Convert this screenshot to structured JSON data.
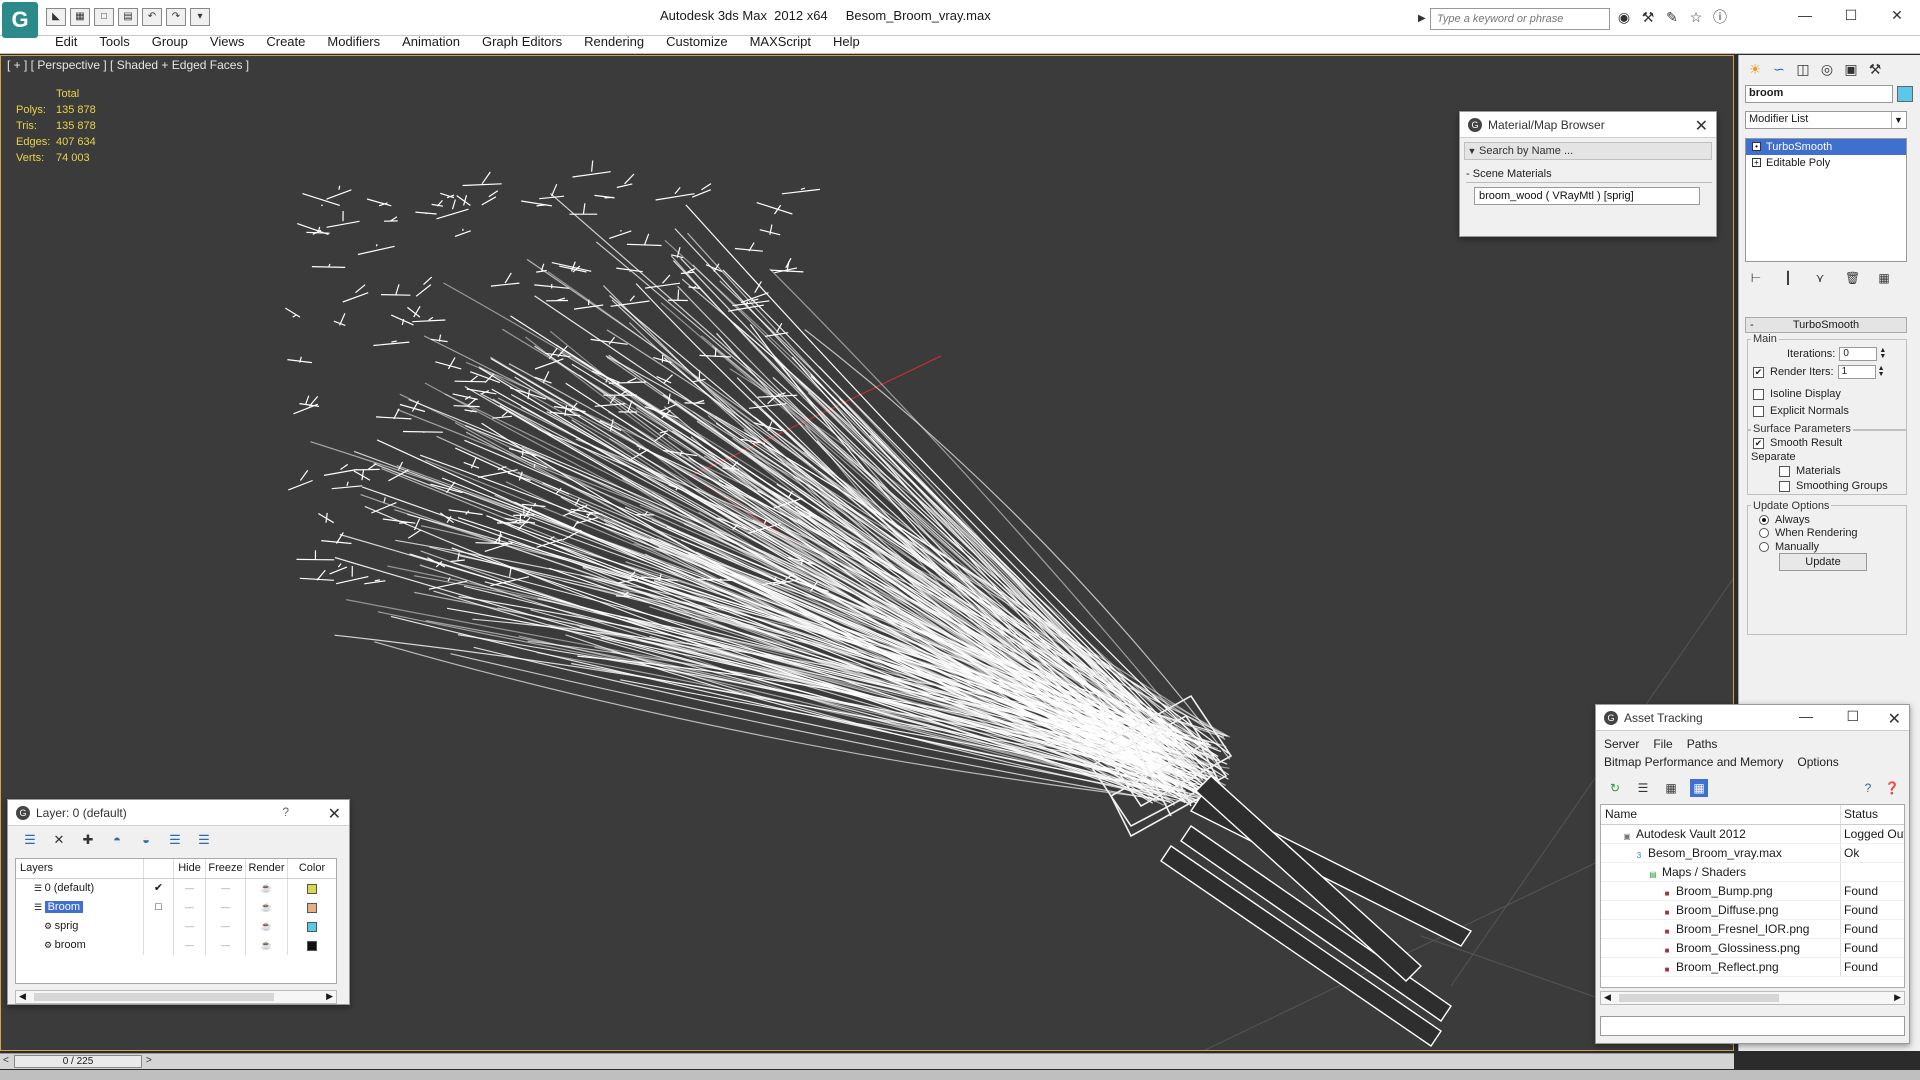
{
  "app": {
    "title": "Autodesk 3ds Max  2012 x64     Besom_Broom_vray.max",
    "logo": "3ds-max-logo",
    "search_placeholder": "Type a keyword or phrase"
  },
  "menu": [
    "Edit",
    "Tools",
    "Group",
    "Views",
    "Create",
    "Modifiers",
    "Animation",
    "Graph Editors",
    "Rendering",
    "Customize",
    "MAXScript",
    "Help"
  ],
  "viewport": {
    "label": "[ + ] [ Perspective ] [ Shaded + Edged Faces ]",
    "stats": {
      "header": "Total",
      "rows": [
        {
          "k": "Polys:",
          "v": "135 878"
        },
        {
          "k": "Tris:",
          "v": "135 878"
        },
        {
          "k": "Edges:",
          "v": "407 634"
        },
        {
          "k": "Verts:",
          "v": "74 003"
        }
      ]
    }
  },
  "material_browser": {
    "title": "Material/Map Browser",
    "search": "Search by Name ...",
    "section": "Scene Materials",
    "entry": "broom_wood  ( VRayMtl )  [sprig]"
  },
  "command_panel": {
    "object_name": "broom",
    "object_color": "#5cc8e8",
    "modifier_list": "Modifier List",
    "stack": [
      {
        "label": "TurboSmooth",
        "selected": true
      },
      {
        "label": "Editable Poly",
        "selected": false
      }
    ],
    "rollout": "TurboSmooth",
    "main_group": "Main",
    "iterations_label": "Iterations:",
    "iterations_value": "0",
    "render_iters_label": "Render Iters:",
    "render_iters_value": "1",
    "isoline": "Isoline Display",
    "explicit_normals": "Explicit Normals",
    "surface_group": "Surface Parameters",
    "smooth_result": "Smooth Result",
    "separate": "Separate",
    "materials": "Materials",
    "smoothing_groups": "Smoothing Groups",
    "update_group": "Update Options",
    "always": "Always",
    "when_rendering": "When Rendering",
    "manually": "Manually",
    "update_btn": "Update"
  },
  "layer_manager": {
    "title": "Layer: 0 (default)",
    "help": "?",
    "columns": [
      "Layers",
      "Hide",
      "Freeze",
      "Render",
      "Color"
    ],
    "rows": [
      {
        "name": "0 (default)",
        "indent": 1,
        "current": "✔",
        "color": "#d8d84a",
        "selected": false
      },
      {
        "name": "Broom",
        "indent": 1,
        "current": "□",
        "color": "#e8b080",
        "selected": true
      },
      {
        "name": "sprig",
        "indent": 2,
        "current": "",
        "color": "#5cc8e8",
        "selected": false
      },
      {
        "name": "broom",
        "indent": 2,
        "current": "",
        "color": "#111111",
        "selected": false
      }
    ]
  },
  "asset_tracking": {
    "title": "Asset Tracking",
    "menu": [
      "Server",
      "File",
      "Paths"
    ],
    "menu2": [
      "Bitmap Performance and Memory",
      "Options"
    ],
    "columns": [
      "Name",
      "Status"
    ],
    "rows": [
      {
        "name": "Autodesk Vault 2012",
        "status": "Logged Out",
        "indent": 20,
        "icon": "vault-icon"
      },
      {
        "name": "Besom_Broom_vray.max",
        "status": "Ok",
        "indent": 32,
        "icon": "max-file-icon"
      },
      {
        "name": "Maps / Shaders",
        "status": "",
        "indent": 46,
        "icon": "maps-icon"
      },
      {
        "name": "Broom_Bump.png",
        "status": "Found",
        "indent": 60,
        "icon": "png-icon"
      },
      {
        "name": "Broom_Diffuse.png",
        "status": "Found",
        "indent": 60,
        "icon": "png-icon"
      },
      {
        "name": "Broom_Fresnel_IOR.png",
        "status": "Found",
        "indent": 60,
        "icon": "png-icon"
      },
      {
        "name": "Broom_Glossiness.png",
        "status": "Found",
        "indent": 60,
        "icon": "png-icon"
      },
      {
        "name": "Broom_Reflect.png",
        "status": "Found",
        "indent": 60,
        "icon": "png-icon"
      }
    ]
  },
  "timeline": {
    "frame": "0 / 225"
  },
  "colors": {
    "selection": "#3f6fcf",
    "viewport_border": "#d2a24c",
    "stats": "#e8d34a"
  }
}
